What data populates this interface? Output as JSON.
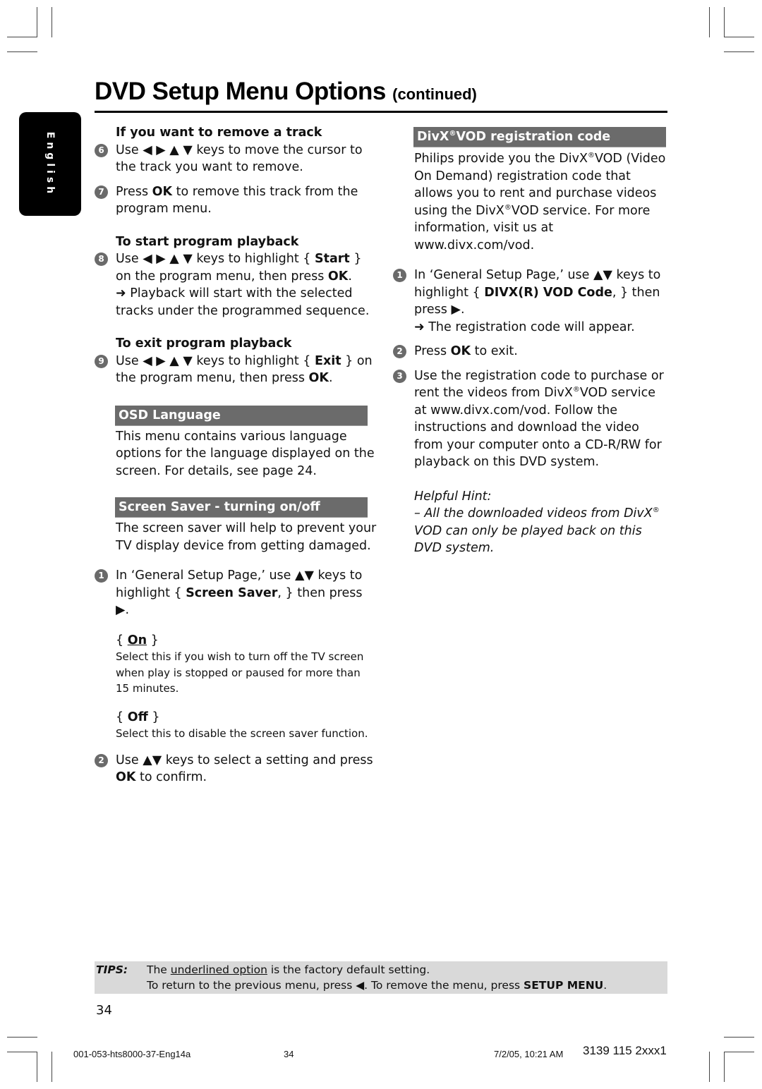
{
  "header": {
    "title": "DVD Setup Menu Options",
    "title_suffix": "(continued)"
  },
  "side_tab": {
    "label": "English"
  },
  "left_column": {
    "remove_track": {
      "heading": "If you want to remove a track",
      "steps": [
        {
          "number": "6",
          "text": "Use ◀ ▶ ▲ ▼ keys to move the cursor to the track you want to remove."
        },
        {
          "number": "7",
          "pre": "Press ",
          "bold": "OK",
          "post": " to remove this track from the program menu."
        }
      ]
    },
    "start_playback": {
      "heading": "To start program playback",
      "step": {
        "number": "8",
        "pre": "Use ◀ ▶ ▲ ▼ keys to highlight { ",
        "bold1": "Start",
        "mid": " } on the program menu, then press ",
        "bold2": "OK",
        "post": ".",
        "result": "➜ Playback will start with the selected tracks under the programmed sequence."
      }
    },
    "exit_playback": {
      "heading": "To exit program playback",
      "step": {
        "number": "9",
        "pre": "Use ◀ ▶ ▲ ▼ keys to highlight { ",
        "bold1": "Exit",
        "mid": " } on the program menu, then press ",
        "bold2": "OK",
        "post": "."
      }
    },
    "osd_language": {
      "title": "OSD Language",
      "body": "This menu contains various language options for the language displayed on the screen.  For details, see page 24."
    },
    "screen_saver": {
      "title": "Screen Saver - turning on/off",
      "body": "The screen saver will help to prevent your TV display device from getting damaged.",
      "step1": {
        "number": "1",
        "pre": "In ‘General Setup Page,’ use ▲▼ keys to highlight { ",
        "bold": "Screen Saver",
        "post": ", } then press ▶."
      },
      "options": [
        {
          "open": "{ ",
          "label": "On",
          "close": " }",
          "default": true,
          "desc": "Select this if you wish to turn off the TV screen when play is stopped or paused for more than 15 minutes."
        },
        {
          "open": "{ ",
          "label": "Off",
          "close": " }",
          "default": false,
          "desc": "Select this to disable the screen saver function."
        }
      ],
      "step2": {
        "number": "2",
        "pre": "Use ▲▼ keys to select a setting and press ",
        "bold": "OK",
        "post": " to confirm."
      }
    }
  },
  "right_column": {
    "divx": {
      "title_pre": "DivX",
      "title_reg": "®",
      "title_post": "VOD registration code",
      "body_1": "Philips provide you the DivX",
      "body_reg": "®",
      "body_2": "VOD (Video On Demand) registration code that allows you to rent and purchase videos using the DivX",
      "body_3": "VOD service. For more information, visit us at www.divx.com/vod.",
      "step1": {
        "number": "1",
        "pre": "In ‘General Setup Page,’ use ▲▼ keys to highlight { ",
        "bold": "DIVX(R) VOD Code",
        "post": ", } then press ▶.",
        "result": "➜ The registration code will appear."
      },
      "step2": {
        "number": "2",
        "pre": "Press ",
        "bold": "OK",
        "post": " to exit."
      },
      "step3": {
        "number": "3",
        "text_1": "Use the registration code to purchase or rent the videos from DivX",
        "text_2": "VOD service at www.divx.com/vod.  Follow the instructions and download the video from your computer onto a CD-R/RW for playback on this DVD system."
      },
      "hint": {
        "title": "Helpful Hint:",
        "text_1": "– All the downloaded videos from DivX",
        "text_2": "VOD can only be played back on this DVD system."
      }
    }
  },
  "tips": {
    "label": "TIPS:",
    "line1_pre": "The ",
    "line1_underlined": "underlined option",
    "line1_post": " is the factory default setting.",
    "line2_pre": "To return to the previous menu, press ◀.  To remove the menu, press ",
    "line2_bold": "SETUP MENU",
    "line2_post": "."
  },
  "page_number": "34",
  "footer": {
    "file": "001-053-hts8000-37-Eng14a",
    "page": "34",
    "datetime": "7/2/05, 10:21 AM",
    "code": "3139 115 2xxx1"
  }
}
